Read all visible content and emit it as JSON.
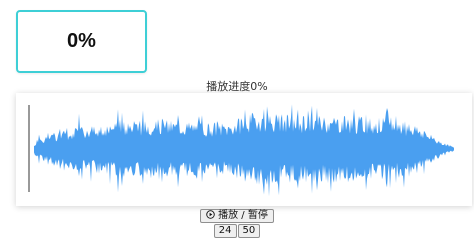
{
  "progress_display": {
    "text": "0%"
  },
  "caption": {
    "text": "播放进度0%"
  },
  "waveform": {
    "progress": 0,
    "wave_color": "#4a9ff0",
    "cursor_color": "#333333"
  },
  "controls": {
    "play_pause_icon": "play-circle-icon",
    "play_pause_label": "播放 / 暂停"
  },
  "rate_buttons": {
    "rate_1": "24",
    "rate_2": "50"
  },
  "colors": {
    "accent_border": "#3ecfd6"
  }
}
